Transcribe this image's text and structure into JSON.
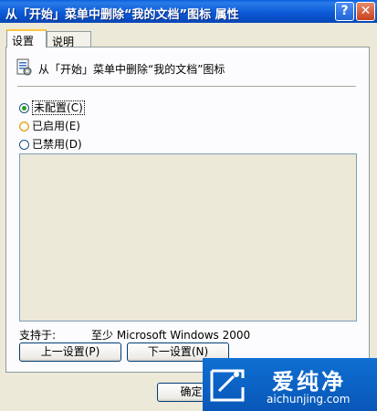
{
  "window": {
    "title": "从「开始」菜单中删除“我的文档”图标 属性",
    "help_glyph": "?",
    "close_glyph": "✕"
  },
  "tabs": [
    {
      "label": "设置",
      "selected": true
    },
    {
      "label": "说明",
      "selected": false
    }
  ],
  "policy": {
    "icon": "policy-setting-icon",
    "name": "从「开始」菜单中删除“我的文档”图标"
  },
  "options": [
    {
      "label": "未配置",
      "mnemonic": "(C)",
      "checked": true
    },
    {
      "label": "已启用",
      "mnemonic": "(E)",
      "checked": false
    },
    {
      "label": "已禁用",
      "mnemonic": "(D)",
      "checked": false
    }
  ],
  "supported": {
    "label": "支持于:",
    "value": "至少 Microsoft Windows 2000"
  },
  "buttons": {
    "previous": "上一设置(P)",
    "next": "下一设置(N)",
    "ok": "确定"
  },
  "watermark": {
    "name": "爱纯净",
    "url": "aichunjing.com"
  }
}
